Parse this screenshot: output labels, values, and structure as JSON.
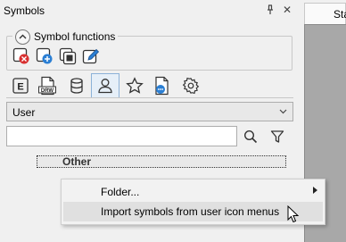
{
  "panel": {
    "title": "Symbols",
    "pin_glyph": "ᵖ",
    "close_glyph": "✕"
  },
  "symbol_functions": {
    "label": "Symbol functions",
    "buttons": [
      {
        "name": "delete-symbol-icon"
      },
      {
        "name": "new-symbol-icon"
      },
      {
        "name": "duplicate-symbol-icon"
      },
      {
        "name": "edit-symbol-icon"
      }
    ]
  },
  "tabs": [
    {
      "name": "tab-e",
      "label": "E"
    },
    {
      "name": "tab-drw",
      "label": "DRW"
    },
    {
      "name": "tab-database"
    },
    {
      "name": "tab-user",
      "active": true
    },
    {
      "name": "tab-favorites"
    },
    {
      "name": "tab-document"
    },
    {
      "name": "tab-settings"
    }
  ],
  "dropdown": {
    "value": "User"
  },
  "search": {
    "value": ""
  },
  "tree": {
    "item_label": "Other"
  },
  "context_menu": {
    "items": [
      {
        "label": "Folder...",
        "submenu": true
      },
      {
        "label": "Import symbols from user icon menus",
        "hover": true
      }
    ]
  },
  "right_panel": {
    "tab_label": "Sta"
  },
  "colors": {
    "accent_blue": "#2b7fd4",
    "delete_red": "#d83030",
    "active_tab_bg": "#e6eff8"
  }
}
